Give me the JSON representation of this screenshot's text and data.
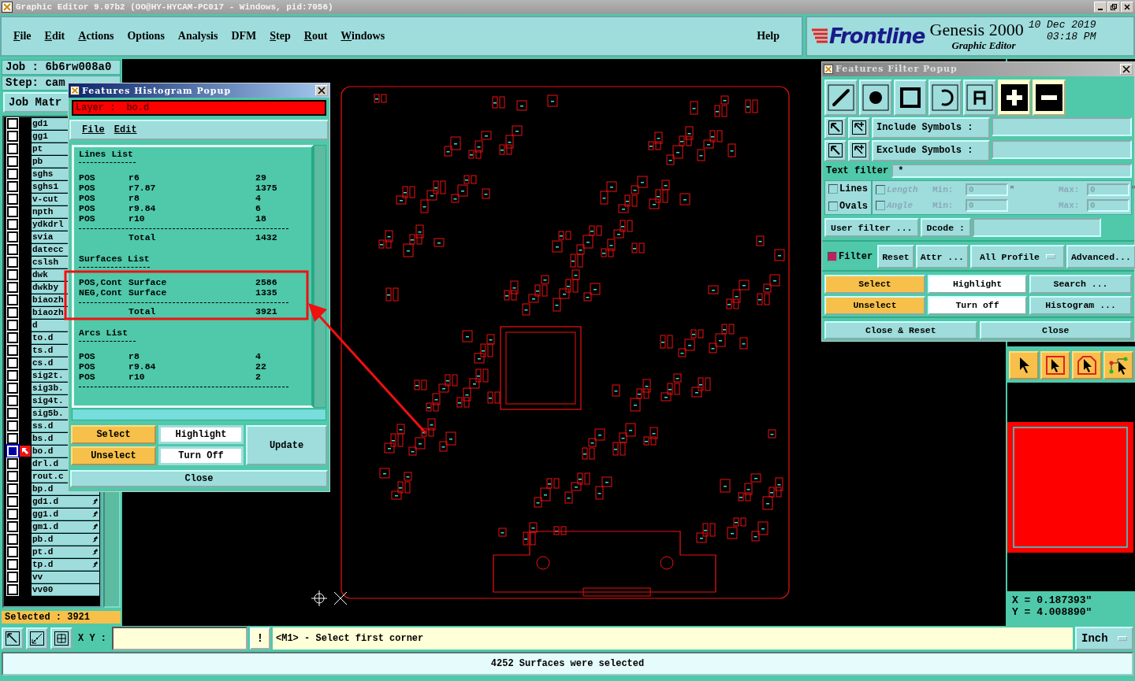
{
  "window": {
    "title": "Graphic Editor 9.07b2 (OO@HY-HYCAM-PC017 - Windows, pid:7056)"
  },
  "menu": [
    {
      "label": "File",
      "mnemonic": true
    },
    {
      "label": "Edit",
      "mnemonic": true
    },
    {
      "label": "Actions",
      "mnemonic": true
    },
    {
      "label": "Options",
      "mnemonic": false
    },
    {
      "label": "Analysis",
      "mnemonic": false
    },
    {
      "label": "DFM",
      "mnemonic": false
    },
    {
      "label": "Step",
      "mnemonic": true
    },
    {
      "label": "Rout",
      "mnemonic": true
    },
    {
      "label": "Windows",
      "mnemonic": true
    }
  ],
  "help": "Help",
  "brand": {
    "logo": "Frontline",
    "product": "Genesis 2000",
    "subtitle": "Graphic Editor",
    "date": "10 Dec 2019",
    "time": "03:18 PM"
  },
  "job_panel": {
    "job": "Job : 6b6rw008a0",
    "step": "Step: cam",
    "matrix_button": "Job Matr",
    "selected_count": "Selected : 3921",
    "layers": [
      {
        "name": "gd1",
        "selected": false
      },
      {
        "name": "gg1",
        "selected": false
      },
      {
        "name": "pt",
        "selected": false
      },
      {
        "name": "pb",
        "selected": false
      },
      {
        "name": "sghs",
        "selected": false
      },
      {
        "name": "sghs1",
        "selected": false
      },
      {
        "name": "v-cut",
        "selected": false
      },
      {
        "name": "npth",
        "selected": false
      },
      {
        "name": "ydkdrl",
        "selected": false
      },
      {
        "name": "svia",
        "selected": false
      },
      {
        "name": "datecc",
        "selected": false
      },
      {
        "name": "cslsh",
        "selected": false
      },
      {
        "name": "dwk",
        "selected": false
      },
      {
        "name": "dwkby",
        "selected": false
      },
      {
        "name": "biaozh",
        "selected": false
      },
      {
        "name": "biaozh",
        "selected": false
      },
      {
        "name": "d",
        "selected": false
      },
      {
        "name": "to.d",
        "selected": false
      },
      {
        "name": "ts.d",
        "selected": false
      },
      {
        "name": "cs.d",
        "selected": false
      },
      {
        "name": "sig2t.",
        "selected": false
      },
      {
        "name": "sig3b.",
        "selected": false
      },
      {
        "name": "sig4t.",
        "selected": false
      },
      {
        "name": "sig5b.",
        "selected": false
      },
      {
        "name": "ss.d",
        "selected": false
      },
      {
        "name": "bs.d",
        "selected": false
      },
      {
        "name": "bo.d",
        "selected": true
      },
      {
        "name": "drl.d",
        "selected": false
      },
      {
        "name": "rout.c",
        "selected": false
      },
      {
        "name": "bp.d",
        "selected": false
      },
      {
        "name": "gd1.d",
        "selected": false,
        "flagged": true
      },
      {
        "name": "gg1.d",
        "selected": false,
        "flagged": true
      },
      {
        "name": "gm1.d",
        "selected": false,
        "flagged": true
      },
      {
        "name": "pb.d",
        "selected": false,
        "flagged": true
      },
      {
        "name": "pt.d",
        "selected": false,
        "flagged": true
      },
      {
        "name": "tp.d",
        "selected": false,
        "flagged": true
      },
      {
        "name": "vv",
        "selected": false,
        "flagged": false
      },
      {
        "name": "vv00",
        "selected": false,
        "flagged": false
      }
    ]
  },
  "histogram_popup": {
    "title": "Features Histogram Popup",
    "layer_label": "Layer :",
    "layer": "bo.d",
    "menu": [
      "File",
      "Edit"
    ],
    "sections": [
      {
        "title": "Lines List",
        "total_label": "Total",
        "total": "1432",
        "rows": [
          {
            "polarity": "POS",
            "symbol": "r6",
            "count": "29"
          },
          {
            "polarity": "POS",
            "symbol": "r7.87",
            "count": "1375"
          },
          {
            "polarity": "POS",
            "symbol": "r8",
            "count": "4"
          },
          {
            "polarity": "POS",
            "symbol": "r9.84",
            "count": "6"
          },
          {
            "polarity": "POS",
            "symbol": "r10",
            "count": "18"
          }
        ]
      },
      {
        "title": "Surfaces List",
        "total_label": "Total",
        "total": "3921",
        "rows": [
          {
            "polarity": "POS,Cont",
            "symbol": "Surface",
            "count": "2586"
          },
          {
            "polarity": "NEG,Cont",
            "symbol": "Surface",
            "count": "1335"
          }
        ]
      },
      {
        "title": "Arcs List",
        "rows": [
          {
            "polarity": "POS",
            "symbol": "r8",
            "count": "4"
          },
          {
            "polarity": "POS",
            "symbol": "r9.84",
            "count": "22"
          },
          {
            "polarity": "POS",
            "symbol": "r10",
            "count": "2"
          }
        ]
      }
    ],
    "buttons": [
      {
        "label": "Select",
        "kind": "primary"
      },
      {
        "label": "Highlight",
        "kind": "toggle"
      },
      {
        "label": "Unselect",
        "kind": "primary"
      },
      {
        "label": "Turn Off",
        "kind": "toggle"
      }
    ],
    "update": "Update",
    "close": "Close"
  },
  "filter_popup": {
    "title": "Features Filter Popup",
    "include_label": "Include Symbols :",
    "exclude_label": "Exclude Symbols :",
    "text_filter_label": "Text filter",
    "text_filter": "*",
    "types": [
      {
        "label": "Lines",
        "checked": false
      },
      {
        "label": "Ovals",
        "checked": false
      }
    ],
    "ranges": [
      {
        "label": "Length",
        "checked": false,
        "min_label": "Min:",
        "min": "0",
        "max_label": "Max:",
        "max": "0",
        "unit": "\""
      },
      {
        "label": "Angle",
        "checked": false,
        "min_label": "Min:",
        "min": "0",
        "max_label": "Max:",
        "max": "0"
      }
    ],
    "user_filter": "User filter ...",
    "dcode_label": "Dcode :",
    "filter": {
      "label": "Filter",
      "checked": true
    },
    "options": [
      "Reset",
      "Attr ...",
      "All Profile",
      "Advanced..."
    ],
    "actions": [
      {
        "label": "Select",
        "kind": "primary"
      },
      {
        "label": "Highlight",
        "kind": "toggle"
      },
      {
        "label": "Search ...",
        "kind": "plain"
      },
      {
        "label": "Unselect",
        "kind": "primary"
      },
      {
        "label": "Turn off",
        "kind": "toggle"
      },
      {
        "label": "Histogram ...",
        "kind": "plain"
      },
      {
        "label": "Close & Reset",
        "kind": "plain"
      },
      {
        "label": "Close",
        "kind": "plain"
      }
    ]
  },
  "right_panel": {
    "x": "X = 0.187393\"",
    "y": "Y = 4.008890\""
  },
  "command_bar": {
    "xy_label": "X Y :",
    "alert": "!",
    "prompt": "<M1> - Select first corner",
    "units": "Inch"
  },
  "status_bar": "4252 Surfaces were selected"
}
